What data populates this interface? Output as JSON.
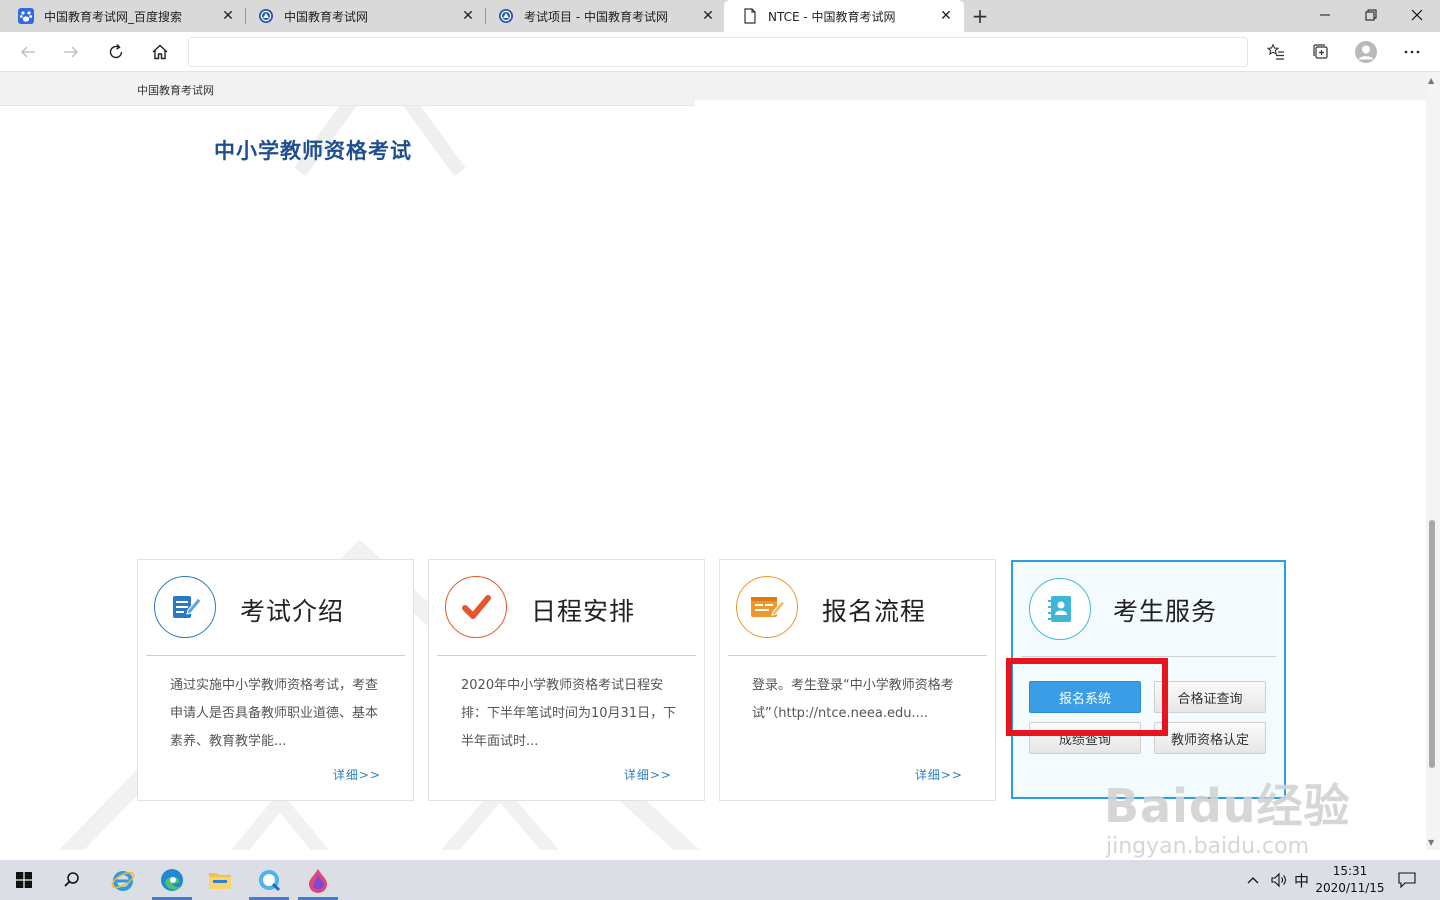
{
  "browser": {
    "tabs": [
      {
        "title": "中国教育考试网_百度搜索",
        "icon": "baidu-paw-icon",
        "active": false
      },
      {
        "title": "中国教育考试网",
        "icon": "neea-logo-icon",
        "active": false
      },
      {
        "title": "考试项目 - 中国教育考试网",
        "icon": "neea-logo-icon",
        "active": false
      },
      {
        "title": "NTCE - 中国教育考试网",
        "icon": "document-icon",
        "active": true
      }
    ],
    "close_glyph": "✕",
    "new_tab_glyph": "+",
    "address": ""
  },
  "page": {
    "site_link": "中国教育考试网",
    "heading": "中小学教师资格考试",
    "cards": [
      {
        "title": "考试介绍",
        "text": "通过实施中小学教师资格考试，考查申请人是否具备教师职业道德、基本素养、教育教学能...",
        "more": "详细>>",
        "icon": "document-pen-icon",
        "color": "#2a78c8"
      },
      {
        "title": "日程安排",
        "text": "2020年中小学教师资格考试日程安排：下半年笔试时间为10月31日，下半年面试时...",
        "more": "详细>>",
        "icon": "checkmark-icon",
        "color": "#e8552a"
      },
      {
        "title": "报名流程",
        "text": "登录。考生登录“中小学教师资格考试”（http://ntce.neea.edu....",
        "more": "详细>>",
        "icon": "registration-form-icon",
        "color": "#f0962a"
      }
    ],
    "service": {
      "title": "考生服务",
      "icon": "contact-book-icon",
      "color": "#3db6d8",
      "buttons": [
        "报名系统",
        "合格证查询",
        "成绩查询",
        "教师资格认定"
      ]
    }
  },
  "watermark": {
    "brand": "Baidu经验",
    "url": "jingyan.baidu.com"
  },
  "taskbar": {
    "ime": "中",
    "time": "15:31",
    "date": "2020/11/15"
  }
}
